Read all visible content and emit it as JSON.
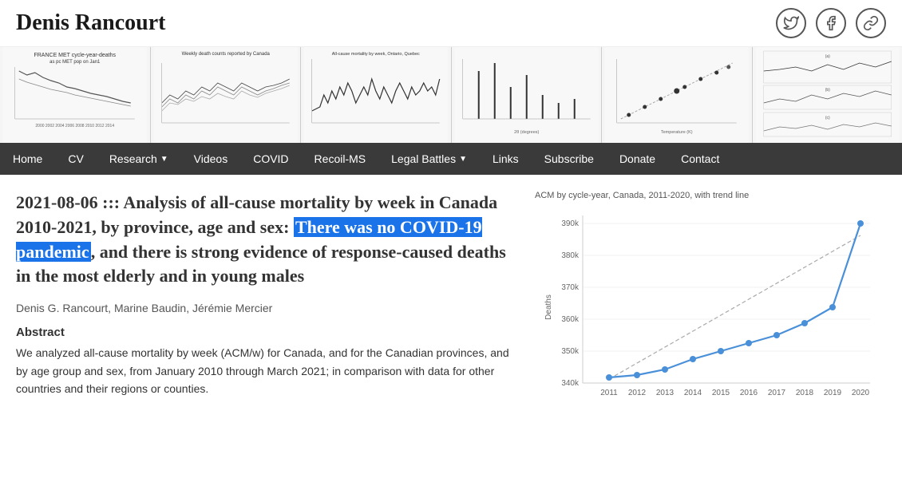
{
  "site": {
    "title": "Denis Rancourt"
  },
  "social": {
    "twitter_label": "Twitter",
    "facebook_label": "Facebook",
    "link_label": "Link"
  },
  "nav": {
    "items": [
      {
        "label": "Home",
        "has_arrow": false
      },
      {
        "label": "CV",
        "has_arrow": false
      },
      {
        "label": "Research",
        "has_arrow": true
      },
      {
        "label": "Videos",
        "has_arrow": false
      },
      {
        "label": "COVID",
        "has_arrow": false
      },
      {
        "label": "Recoil-MS",
        "has_arrow": false
      },
      {
        "label": "Legal Battles",
        "has_arrow": true
      },
      {
        "label": "Links",
        "has_arrow": false
      },
      {
        "label": "Subscribe",
        "has_arrow": false
      },
      {
        "label": "Donate",
        "has_arrow": false
      },
      {
        "label": "Contact",
        "has_arrow": false
      }
    ]
  },
  "article": {
    "date_prefix": "2021-08-06 ::: ",
    "title_before_highlight": "Analysis of all-cause mortality by week in Canada 2010-2021, by province, age and sex: ",
    "title_highlight": "There was no COVID-19 pandemic",
    "title_after": ", and there is strong evidence of response-caused deaths in the most elderly and in young males",
    "authors": "Denis G. Rancourt, Marine Baudin, Jérémie Mercier",
    "abstract_heading": "Abstract",
    "abstract_text": "We analyzed all-cause mortality by week (ACM/w) for Canada, and for the Canadian provinces, and by age group and sex, from January 2010 through March 2021; in comparison with data for other countries and their regions or counties."
  },
  "chart": {
    "title": "ACM by cycle-year, Canada, 2011-2020, with trend line",
    "y_label": "Deaths",
    "y_values": [
      "380k",
      "360k",
      "340k"
    ],
    "x_values": [
      "2011",
      "2012",
      "2013",
      "2014",
      "2015",
      "2016",
      "2017",
      "2018",
      "2019",
      "2020"
    ]
  }
}
